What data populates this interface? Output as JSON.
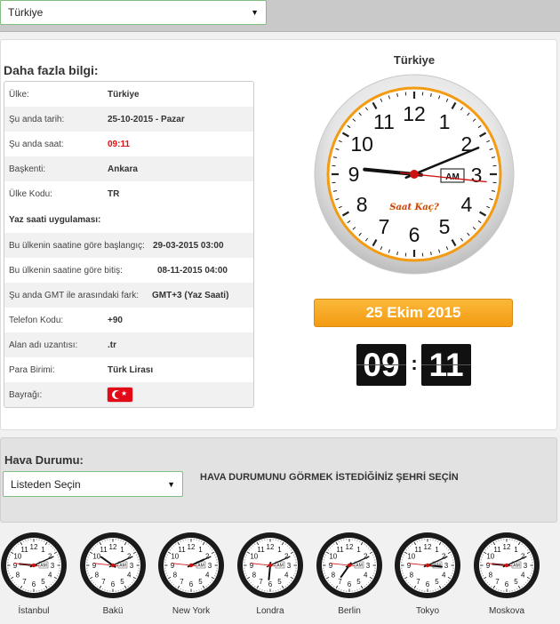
{
  "country_select": {
    "value": "Türkiye"
  },
  "info": {
    "title": "Daha fazla bilgi:",
    "rows": [
      {
        "label": "Ülke:",
        "value": "Türkiye"
      },
      {
        "label": "Şu anda tarih:",
        "value": "25-10-2015 - Pazar"
      },
      {
        "label": "Şu anda saat:",
        "value": "09:11"
      },
      {
        "label": "Başkenti:",
        "value": "Ankara"
      },
      {
        "label": "Ülke Kodu:",
        "value": "TR"
      }
    ],
    "dst_title": "Yaz saati uygulaması:",
    "dst_rows": [
      {
        "label": "Bu ülkenin saatine göre başlangıç:",
        "value": "29-03-2015 03:00"
      },
      {
        "label": "Bu ülkenin saatine göre bitiş:",
        "value": "08-11-2015 04:00"
      },
      {
        "label": "Şu anda GMT ile arasındaki fark:",
        "value": "GMT+3 (Yaz Saati)"
      }
    ],
    "extra_rows": [
      {
        "label": "Telefon Kodu:",
        "value": "+90"
      },
      {
        "label": "Alan adı uzantısı:",
        "value": ".tr"
      },
      {
        "label": "Para Birimi:",
        "value": "Türk Lirası"
      },
      {
        "label": "Bayrağı:",
        "value": ""
      }
    ]
  },
  "clock": {
    "title": "Türkiye",
    "brand": "Saat Kaç?",
    "ampm": "AM",
    "hour": 9,
    "minute": 11,
    "second": 16,
    "date_label": "25 Ekim 2015",
    "digital_hours": "09",
    "digital_minutes": "11",
    "colon": ":"
  },
  "weather": {
    "title": "Hava Durumu:",
    "select_value": "Listeden Seçin",
    "hint": "HAVA DURUMUNU GÖRMEK İSTEDİĞİNİZ ŞEHRİ SEÇİN"
  },
  "cities": [
    {
      "name": "İstanbul",
      "ampm": "AM",
      "hour": 9,
      "minute": 11
    },
    {
      "name": "Bakü",
      "ampm": "AM",
      "hour": 10,
      "minute": 11
    },
    {
      "name": "New York",
      "ampm": "AM",
      "hour": 2,
      "minute": 11
    },
    {
      "name": "Londra",
      "ampm": "AM",
      "hour": 6,
      "minute": 11
    },
    {
      "name": "Berlin",
      "ampm": "AM",
      "hour": 7,
      "minute": 11
    },
    {
      "name": "Tokyo",
      "ampm": "PM",
      "hour": 3,
      "minute": 11
    },
    {
      "name": "Moskova",
      "ampm": "AM",
      "hour": 9,
      "minute": 11
    }
  ],
  "colors": {
    "accent": "#f39b12",
    "second_hand": "#cc1111",
    "panel_bg": "#ffffff"
  }
}
